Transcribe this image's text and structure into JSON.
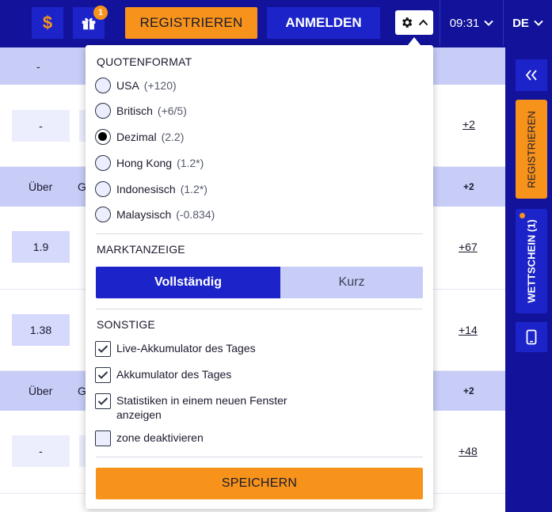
{
  "header": {
    "deposit_icon_glyph": "$",
    "gift_badge_count": "1",
    "register_label": "REGISTRIEREN",
    "login_label": "ANMELDEN",
    "time": "09:31",
    "language": "DE"
  },
  "table": {
    "row1_header_left": "-",
    "row1_odd": "-",
    "row1_more": "+2",
    "header2": {
      "col1": "Über",
      "col2": "G",
      "right": "+2"
    },
    "row2_odd": "1.9",
    "row2_more": "+67",
    "row3_odd": "1.38",
    "row3_more": "+14",
    "header3": {
      "col1": "Über",
      "col2": "G",
      "right": "+2"
    },
    "row4_odd": "-",
    "row4_more": "+48"
  },
  "rail": {
    "register_label": "REGISTRIEREN",
    "betslip_label": "WETTSCHEIN (1)"
  },
  "settings": {
    "odds_format_title": "QUOTENFORMAT",
    "odds_formats": [
      {
        "label": "USA",
        "hint": "(+120)",
        "selected": false
      },
      {
        "label": "Britisch",
        "hint": "(+6/5)",
        "selected": false
      },
      {
        "label": "Dezimal",
        "hint": "(2.2)",
        "selected": true
      },
      {
        "label": "Hong Kong",
        "hint": "(1.2*)",
        "selected": false
      },
      {
        "label": "Indonesisch",
        "hint": "(1.2*)",
        "selected": false
      },
      {
        "label": "Malaysisch",
        "hint": "(-0.834)",
        "selected": false
      }
    ],
    "market_title": "MARKTANZEIGE",
    "market_full": "Vollständig",
    "market_short": "Kurz",
    "other_title": "SONSTIGE",
    "options": [
      {
        "label": "Live-Akkumulator des Tages",
        "checked": true
      },
      {
        "label": "Akkumulator des Tages",
        "checked": true
      },
      {
        "label": "Statistiken in einem neuen Fenster anzeigen",
        "checked": true
      },
      {
        "label": "zone deaktivieren",
        "checked": false
      }
    ],
    "save_label": "SPEICHERN"
  },
  "colors": {
    "brand_blue": "#12129a",
    "accent_blue": "#1c24c9",
    "accent_orange": "#f7931a",
    "light_blue": "#c8cdf7"
  }
}
